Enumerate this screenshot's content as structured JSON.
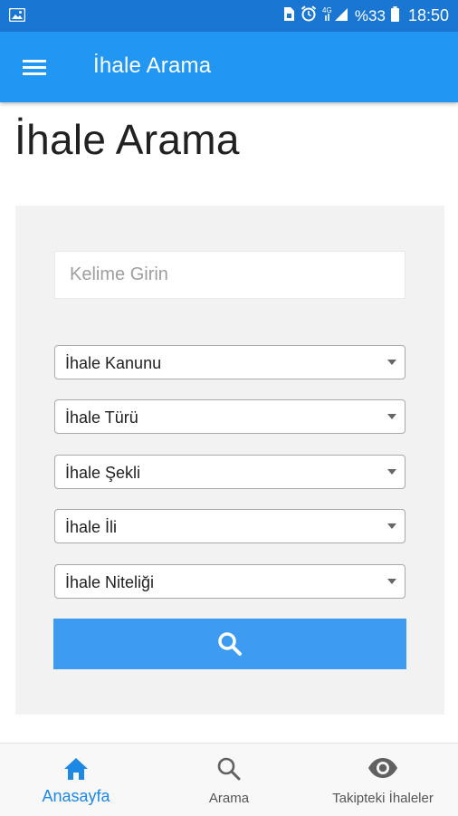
{
  "status_bar": {
    "battery": "%33",
    "time": "18:50",
    "network": "4G"
  },
  "app_bar": {
    "title": "İhale Arama"
  },
  "main": {
    "page_title": "İhale Arama",
    "search": {
      "placeholder": "Kelime Girin",
      "value": ""
    },
    "selects": [
      {
        "label": "İhale Kanunu"
      },
      {
        "label": "İhale Türü"
      },
      {
        "label": "İhale Şekli"
      },
      {
        "label": "İhale İli"
      },
      {
        "label": "İhale Niteliği"
      }
    ]
  },
  "bottom_nav": {
    "items": [
      {
        "label": "Anasayfa",
        "icon": "home-icon",
        "active": true
      },
      {
        "label": "Arama",
        "icon": "search-icon",
        "active": false
      },
      {
        "label": "Takipteki İhaleler",
        "icon": "eye-icon",
        "active": false
      }
    ]
  },
  "colors": {
    "status_bar": "#1976d2",
    "app_bar": "#2196f3",
    "search_button": "#3d9cf2",
    "active_nav": "#1e88e5"
  }
}
